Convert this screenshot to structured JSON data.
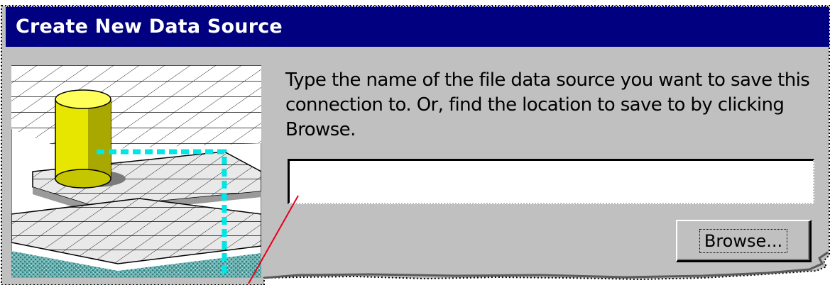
{
  "dialog": {
    "title": "Create New Data Source"
  },
  "description": {
    "lines": [
      "Type the name of the file data source you want to save this",
      "connection to.  Or, find the location to save to by clicking",
      "Browse."
    ]
  },
  "file_name_input": {
    "value": "",
    "placeholder": ""
  },
  "browse_button": {
    "label": "Browse..."
  },
  "colors": {
    "titlebar": "#000080",
    "dialog_face": "#c0c0c0",
    "illustration_dashed_line": "#00e5e5",
    "illustration_cylinder": "#e6e600",
    "pointer_line": "#e8001c"
  },
  "icons": {
    "illustration": "database-cylinder-connection-illustration"
  }
}
